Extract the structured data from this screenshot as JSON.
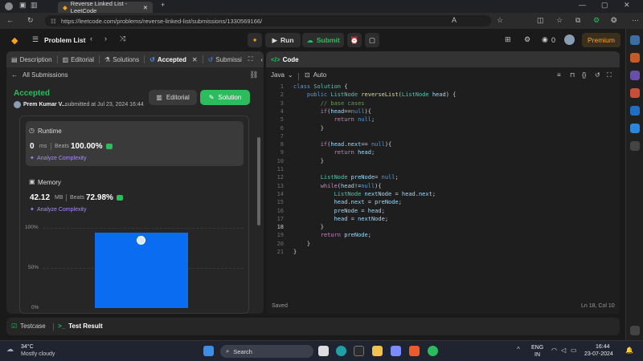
{
  "browser": {
    "tab_title": "Reverse Linked List - LeetCode",
    "url": "https://leetcode.com/problems/reverse-linked-list/submissions/1330569166/"
  },
  "header": {
    "problem_list": "Problem List",
    "run": "Run",
    "submit": "Submit",
    "coins": "0",
    "premium": "Premium"
  },
  "left_tabs": {
    "description": "Description",
    "editorial": "Editorial",
    "solutions": "Solutions",
    "accepted": "Accepted",
    "submissions": "Submissi"
  },
  "submission": {
    "back": "All Submissions",
    "status": "Accepted",
    "author": "Prem Kumar V...",
    "submitted": "submitted at Jul 23, 2024 16:44",
    "editorial_btn": "Editorial",
    "solution_btn": "Solution",
    "runtime_title": "Runtime",
    "runtime_value": "0",
    "runtime_unit": "ms",
    "runtime_beats_label": "Beats",
    "runtime_beats": "100.00%",
    "analyze": "Analyze Complexity",
    "memory_title": "Memory",
    "memory_value": "42.12",
    "memory_unit": "MB",
    "memory_beats_label": "Beats",
    "memory_beats": "72.98%",
    "chart_ticks": [
      "100%",
      "50%",
      "0%"
    ]
  },
  "code_panel": {
    "title": "Code",
    "language": "Java",
    "mode": "Auto",
    "status": "Saved",
    "position": "Ln 18, Col 10"
  },
  "bottom": {
    "testcase": "Testcase",
    "test_result": "Test Result"
  },
  "taskbar": {
    "weather_temp": "34°C",
    "weather_desc": "Mostly cloudy",
    "search": "Search",
    "lang1": "ENG",
    "lang2": "IN",
    "time": "16:44",
    "date": "23-07-2024"
  },
  "colors": {
    "accent_green": "#2cbb5d",
    "premium": "#ffa116",
    "bar_blue": "#0a6cf0"
  }
}
